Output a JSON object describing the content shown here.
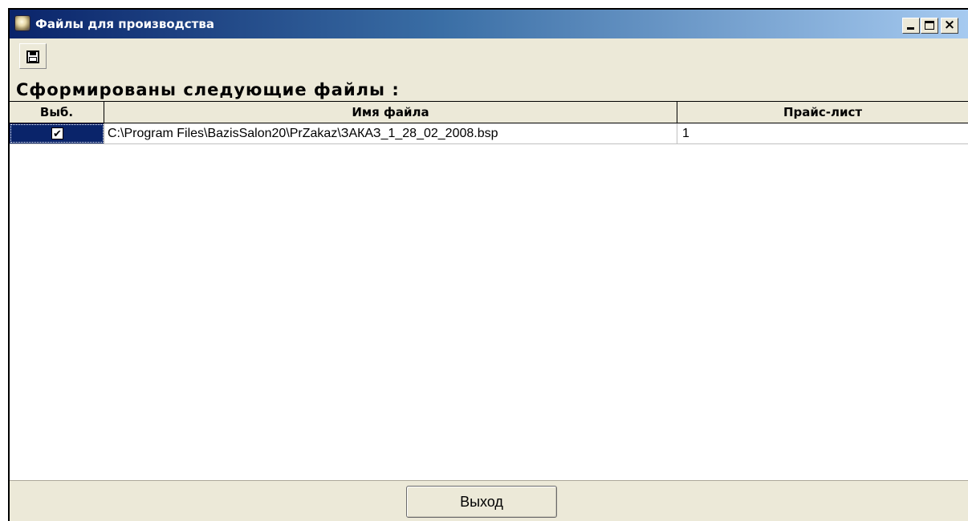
{
  "window": {
    "title": "Файлы для производства",
    "controls": {
      "minimize": "_",
      "maximize": "□",
      "close": "×"
    }
  },
  "toolbar": {
    "save_icon": "floppy-disk-icon"
  },
  "section": {
    "label": "Сформированы следующие файлы :"
  },
  "grid": {
    "columns": [
      "Выб.",
      "Имя файла",
      "Прайс-лист"
    ],
    "rows": [
      {
        "selected": true,
        "check_mark": "✔",
        "file_name": "C:\\Program Files\\BazisSalon20\\PrZakaz\\ЗАКАЗ_1_28_02_2008.bsp",
        "price_list": "1"
      }
    ]
  },
  "buttons": {
    "exit": "Выход"
  },
  "colors": {
    "title_start": "#0a246a",
    "title_end": "#a6caf0",
    "selection": "#0a246a",
    "face": "#ece9d8"
  }
}
